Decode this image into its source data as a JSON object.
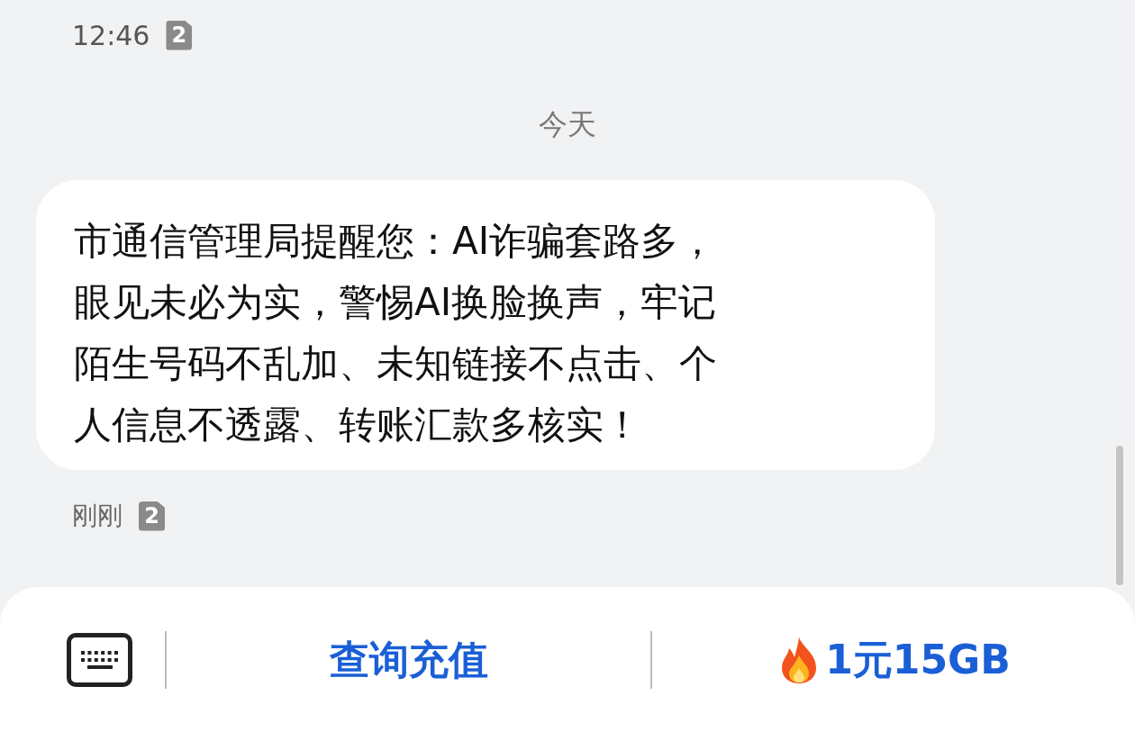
{
  "status_bar": {
    "time": "12:46",
    "sim": "2"
  },
  "date_divider": "今天",
  "message": {
    "lines": [
      "市通信管理局提醒您：AI诈骗套路多，",
      "眼见未必为实，警惕AI换脸换声，牢记",
      "陌生号码不乱加、未知链接不点击、个",
      "人信息不透露、转账汇款多核实！"
    ],
    "time": "刚刚",
    "sim": "2"
  },
  "bottom_bar": {
    "buttons": [
      "查询充值",
      "1元15GB"
    ]
  }
}
